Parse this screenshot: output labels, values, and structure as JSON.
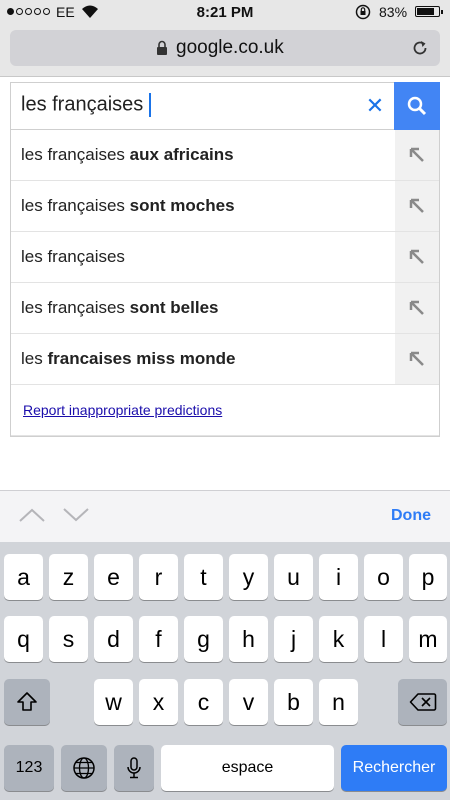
{
  "status": {
    "carrier": "EE",
    "time": "8:21 PM",
    "battery_pct": "83%",
    "battery_level": 0.83
  },
  "browser": {
    "url": "google.co.uk"
  },
  "search": {
    "query": "les françaises"
  },
  "suggestions": [
    {
      "prefix": "les françaises ",
      "bold": "aux africains"
    },
    {
      "prefix": "les françaises ",
      "bold": "sont moches"
    },
    {
      "prefix": "les françaises",
      "bold": ""
    },
    {
      "prefix": "les françaises ",
      "bold": "sont belles"
    },
    {
      "prefix": "les ",
      "bold": "francaises miss monde"
    }
  ],
  "report_link": "Report inappropriate predictions",
  "accessory": {
    "done_label": "Done"
  },
  "keyboard": {
    "row1": [
      "a",
      "z",
      "e",
      "r",
      "t",
      "y",
      "u",
      "i",
      "o",
      "p"
    ],
    "row2": [
      "q",
      "s",
      "d",
      "f",
      "g",
      "h",
      "j",
      "k",
      "l",
      "m"
    ],
    "row3": [
      "w",
      "x",
      "c",
      "v",
      "b",
      "n"
    ],
    "numbers_label": "123",
    "space_label": "espace",
    "return_label": "Rechercher"
  },
  "colors": {
    "accent": "#4285f4",
    "link": "#1a0dab",
    "ios_blue": "#2e7cf6"
  }
}
